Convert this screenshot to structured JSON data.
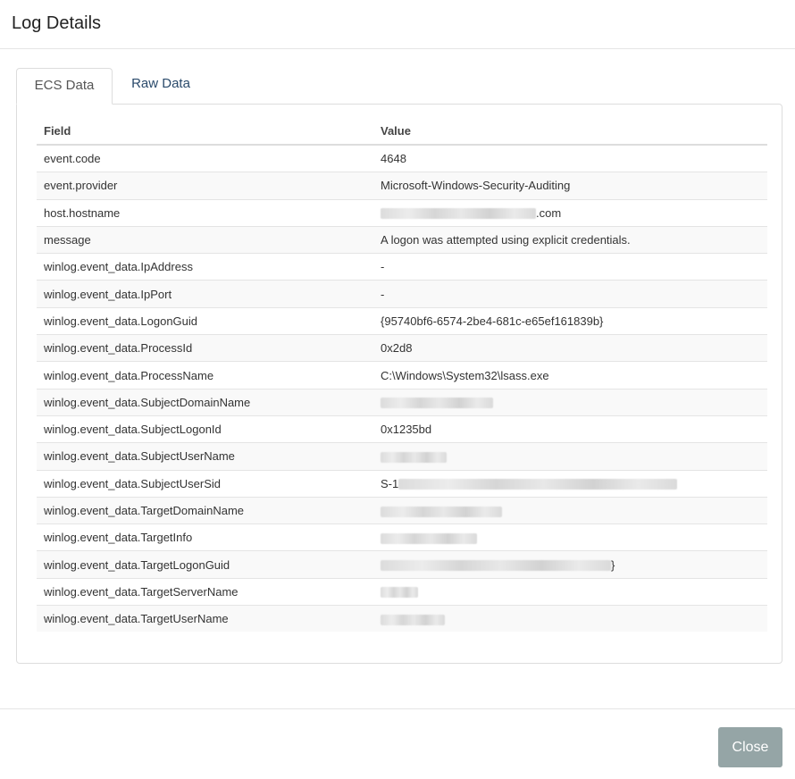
{
  "modal": {
    "title": "Log Details"
  },
  "tabs": [
    {
      "label": "ECS Data",
      "active": true
    },
    {
      "label": "Raw Data",
      "active": false
    }
  ],
  "table": {
    "headers": {
      "field": "Field",
      "value": "Value"
    },
    "rows": [
      {
        "field": "event.code",
        "value": "4648"
      },
      {
        "field": "event.provider",
        "value": "Microsoft-Windows-Security-Auditing"
      },
      {
        "field": "host.hostname",
        "value": ".com",
        "redacted_prefix": true
      },
      {
        "field": "message",
        "value": "A logon was attempted using explicit credentials."
      },
      {
        "field": "winlog.event_data.IpAddress",
        "value": "-"
      },
      {
        "field": "winlog.event_data.IpPort",
        "value": "-"
      },
      {
        "field": "winlog.event_data.LogonGuid",
        "value": "{95740bf6-6574-2be4-681c-e65ef161839b}"
      },
      {
        "field": "winlog.event_data.ProcessId",
        "value": "0x2d8"
      },
      {
        "field": "winlog.event_data.ProcessName",
        "value": "C:\\Windows\\System32\\lsass.exe"
      },
      {
        "field": "winlog.event_data.SubjectDomainName",
        "value": "",
        "redacted": true
      },
      {
        "field": "winlog.event_data.SubjectLogonId",
        "value": "0x1235bd"
      },
      {
        "field": "winlog.event_data.SubjectUserName",
        "value": "",
        "redacted": true
      },
      {
        "field": "winlog.event_data.SubjectUserSid",
        "value": "S-1",
        "redacted_suffix": true
      },
      {
        "field": "winlog.event_data.TargetDomainName",
        "value": "",
        "redacted": true
      },
      {
        "field": "winlog.event_data.TargetInfo",
        "value": "",
        "redacted": true
      },
      {
        "field": "winlog.event_data.TargetLogonGuid",
        "value": "}",
        "redacted_prefix": true
      },
      {
        "field": "winlog.event_data.TargetServerName",
        "value": "",
        "redacted": true
      },
      {
        "field": "winlog.event_data.TargetUserName",
        "value": "",
        "redacted": true
      }
    ]
  },
  "footer": {
    "close_label": "Close"
  },
  "colors": {
    "close_button": "#95a5a6",
    "tab_link": "#2a4a6b",
    "stripe": "#f9f9f9"
  }
}
